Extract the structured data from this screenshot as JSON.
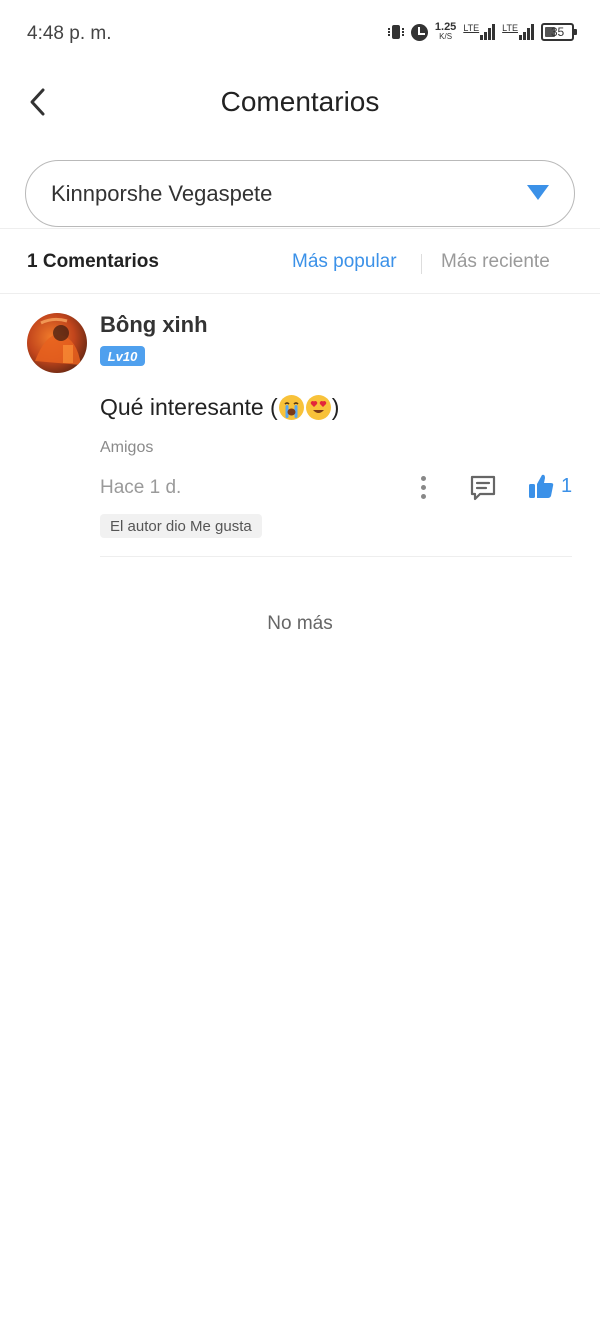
{
  "status_bar": {
    "time": "4:48 p. m.",
    "speed_value": "1.25",
    "speed_unit": "K/S",
    "network_1": "LTE",
    "network_2": "LTE",
    "battery": "35",
    "icons": [
      "vibrate-icon",
      "alarm-icon",
      "signal-icon",
      "battery-icon"
    ]
  },
  "header": {
    "title": "Comentarios",
    "back_icon": "chevron-left-icon"
  },
  "selector": {
    "label": "Kinnporshe Vegaspete",
    "icon": "triangle-down-icon"
  },
  "sort_bar": {
    "count_label": "1 Comentarios",
    "popular_label": "Más popular",
    "recent_label": "Más reciente",
    "active": "popular"
  },
  "comments": [
    {
      "username": "Bông xinh",
      "level": "Lv10",
      "text": "Qué interesante (",
      "text_end": ")",
      "emojis": [
        "crying-face-emoji",
        "heart-eyes-emoji"
      ],
      "relation": "Amigos",
      "time": "Hace 1 d.",
      "likes": "1",
      "author_liked": "El autor dio Me gusta"
    }
  ],
  "footer": {
    "no_more": "No más"
  },
  "colors": {
    "accent": "#3b91e8",
    "badge": "#4fa0ee",
    "muted": "#9a9a9a"
  }
}
